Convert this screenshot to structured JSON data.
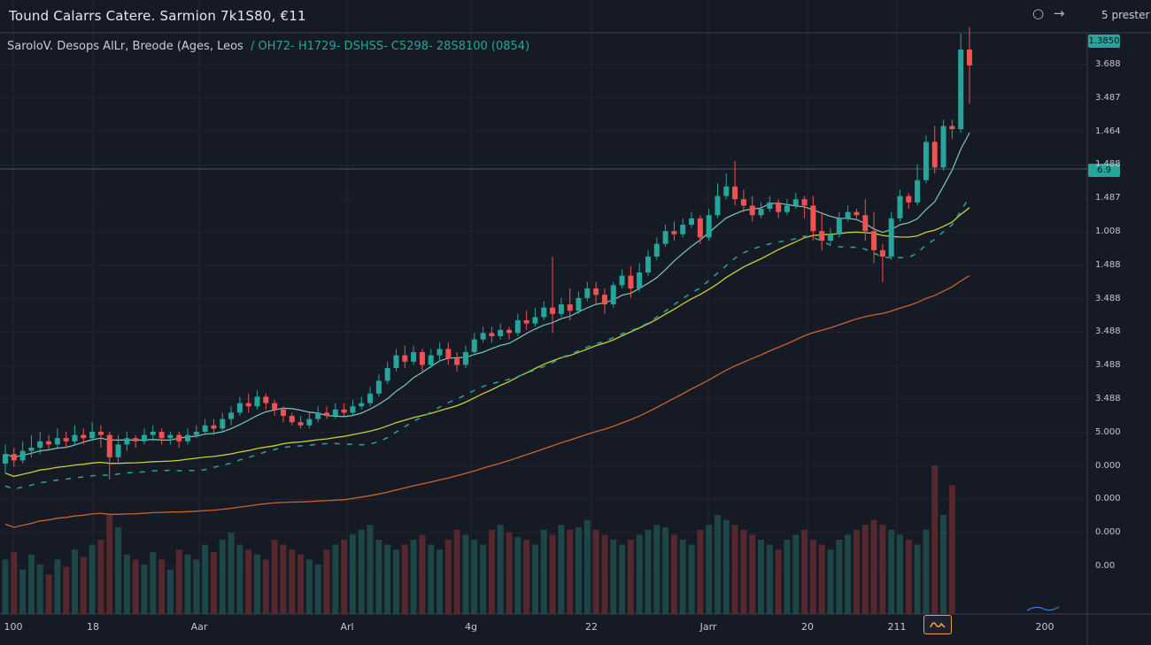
{
  "header": {
    "title": "Tound Calarrs Catere. Sarmion  7k1S80, €11",
    "subtitle": "SaroloV. Desops AlLr, Breode (Ages, Leos",
    "ohlc": "/ OH72- H1729- DSHSS- C5298- 28S8100 (0854)",
    "preset_label": "5 prester",
    "icon_circle": "○",
    "icon_arrow": "→"
  },
  "price_tags": {
    "top": "1.3850",
    "current": "6.9"
  },
  "icons": {
    "chart_toggle": "chart-wave-icon"
  },
  "colors": {
    "background": "#161a25",
    "up": "#26a69a",
    "down": "#ef5350",
    "ma_fast": "#7ec9b8",
    "ma_mid": "#c8d033",
    "ma_slow": "#c8632c",
    "ma_dashed": "#26a69a"
  },
  "chart_data": {
    "type": "candlestick",
    "y_tick_labels": [
      "3.688",
      "3.487",
      "1.464",
      "1.488",
      "1.487",
      "1.008",
      "1.488",
      "3.488",
      "3.488",
      "3.488",
      "3.488",
      "5.000",
      "0.000",
      "0.000",
      "0.000",
      "0.00"
    ],
    "x_tick_labels": [
      "100",
      "18",
      "Aar",
      "Arl",
      "4g",
      "22",
      "Jarr",
      "20",
      "211",
      "200"
    ],
    "ylim": [
      0,
      100
    ],
    "candles": [
      [
        15,
        18,
        12,
        21
      ],
      [
        18,
        16,
        14,
        20
      ],
      [
        16,
        19,
        15,
        22
      ],
      [
        19,
        20,
        17,
        24
      ],
      [
        20,
        22,
        18,
        25
      ],
      [
        22,
        21,
        19,
        24
      ],
      [
        21,
        23,
        20,
        26
      ],
      [
        23,
        22,
        20,
        25
      ],
      [
        22,
        24,
        21,
        27
      ],
      [
        24,
        23,
        21,
        26
      ],
      [
        23,
        25,
        22,
        28
      ],
      [
        25,
        24,
        20,
        27
      ],
      [
        24,
        17,
        10,
        25
      ],
      [
        17,
        21,
        15,
        24
      ],
      [
        21,
        23,
        19,
        25
      ],
      [
        23,
        22,
        20,
        24
      ],
      [
        22,
        24,
        21,
        26
      ],
      [
        24,
        25,
        22,
        27
      ],
      [
        25,
        23,
        21,
        26
      ],
      [
        23,
        24,
        21,
        25
      ],
      [
        24,
        22,
        20,
        25
      ],
      [
        22,
        24,
        21,
        26
      ],
      [
        24,
        25,
        23,
        27
      ],
      [
        25,
        27,
        24,
        29
      ],
      [
        27,
        26,
        24,
        29
      ],
      [
        26,
        29,
        25,
        31
      ],
      [
        29,
        31,
        27,
        33
      ],
      [
        31,
        34,
        30,
        36
      ],
      [
        34,
        33,
        31,
        37
      ],
      [
        33,
        36,
        32,
        38
      ],
      [
        36,
        34,
        32,
        37
      ],
      [
        34,
        32,
        30,
        35
      ],
      [
        32,
        30,
        28,
        33
      ],
      [
        30,
        28,
        27,
        31
      ],
      [
        28,
        27,
        26,
        30
      ],
      [
        27,
        29,
        26,
        31
      ],
      [
        29,
        31,
        28,
        33
      ],
      [
        31,
        30,
        29,
        33
      ],
      [
        30,
        32,
        29,
        34
      ],
      [
        32,
        31,
        30,
        34
      ],
      [
        31,
        33,
        30,
        35
      ],
      [
        33,
        34,
        32,
        36
      ],
      [
        34,
        37,
        33,
        39
      ],
      [
        37,
        41,
        36,
        43
      ],
      [
        41,
        45,
        40,
        47
      ],
      [
        45,
        49,
        44,
        51
      ],
      [
        49,
        47,
        45,
        52
      ],
      [
        47,
        50,
        46,
        52
      ],
      [
        50,
        46,
        44,
        51
      ],
      [
        46,
        49,
        45,
        51
      ],
      [
        49,
        51,
        47,
        53
      ],
      [
        51,
        48,
        46,
        53
      ],
      [
        48,
        46,
        44,
        50
      ],
      [
        46,
        50,
        45,
        52
      ],
      [
        50,
        54,
        49,
        56
      ],
      [
        54,
        56,
        53,
        58
      ],
      [
        56,
        55,
        53,
        58
      ],
      [
        55,
        57,
        54,
        59
      ],
      [
        57,
        56,
        54,
        58
      ],
      [
        56,
        60,
        55,
        62
      ],
      [
        60,
        59,
        57,
        63
      ],
      [
        59,
        61,
        58,
        64
      ],
      [
        61,
        64,
        60,
        66
      ],
      [
        64,
        62,
        56,
        80
      ],
      [
        62,
        65,
        61,
        67
      ],
      [
        65,
        63,
        60,
        70
      ],
      [
        63,
        67,
        62,
        69
      ],
      [
        67,
        70,
        66,
        72
      ],
      [
        70,
        68,
        65,
        72
      ],
      [
        68,
        65,
        62,
        70
      ],
      [
        65,
        71,
        64,
        72
      ],
      [
        71,
        74,
        70,
        76
      ],
      [
        74,
        70,
        67,
        77
      ],
      [
        70,
        75,
        69,
        78
      ],
      [
        75,
        80,
        74,
        82
      ],
      [
        80,
        84,
        79,
        86
      ],
      [
        84,
        88,
        83,
        90
      ],
      [
        88,
        87,
        85,
        91
      ],
      [
        87,
        90,
        86,
        92
      ],
      [
        90,
        92,
        89,
        94
      ],
      [
        92,
        86,
        84,
        93
      ],
      [
        86,
        93,
        85,
        95
      ],
      [
        93,
        99,
        92,
        103
      ],
      [
        99,
        102,
        98,
        106
      ],
      [
        102,
        98,
        96,
        110
      ],
      [
        98,
        96,
        94,
        101
      ],
      [
        96,
        93,
        91,
        99
      ],
      [
        93,
        95,
        92,
        97
      ],
      [
        95,
        97,
        94,
        99
      ],
      [
        97,
        94,
        92,
        98
      ],
      [
        94,
        96,
        93,
        98
      ],
      [
        96,
        98,
        95,
        100
      ],
      [
        98,
        96,
        92,
        99
      ],
      [
        96,
        88,
        85,
        99
      ],
      [
        88,
        85,
        82,
        94
      ],
      [
        85,
        87,
        84,
        89
      ],
      [
        87,
        92,
        86,
        94
      ],
      [
        92,
        94,
        91,
        96
      ],
      [
        94,
        93,
        92,
        95
      ],
      [
        93,
        88,
        85,
        98
      ],
      [
        88,
        82,
        78,
        94
      ],
      [
        82,
        80,
        72,
        84
      ],
      [
        80,
        92,
        79,
        94
      ],
      [
        92,
        99,
        91,
        101
      ],
      [
        99,
        97,
        95,
        100
      ],
      [
        97,
        104,
        96,
        109
      ],
      [
        104,
        116,
        103,
        118
      ],
      [
        116,
        108,
        106,
        121
      ],
      [
        108,
        121,
        107,
        123
      ],
      [
        121,
        120,
        117,
        123
      ],
      [
        120,
        145,
        119,
        150
      ],
      [
        145,
        140,
        128,
        152
      ]
    ],
    "volume": [
      22,
      25,
      18,
      24,
      20,
      16,
      22,
      19,
      26,
      23,
      28,
      30,
      40,
      35,
      24,
      22,
      20,
      25,
      22,
      18,
      26,
      24,
      22,
      28,
      25,
      30,
      33,
      28,
      26,
      24,
      22,
      30,
      28,
      26,
      24,
      22,
      20,
      26,
      28,
      30,
      32,
      34,
      36,
      30,
      28,
      26,
      28,
      30,
      32,
      28,
      26,
      30,
      34,
      32,
      30,
      28,
      34,
      36,
      33,
      31,
      30,
      28,
      34,
      32,
      36,
      34,
      35,
      38,
      34,
      32,
      30,
      28,
      30,
      32,
      34,
      36,
      35,
      32,
      30,
      28,
      34,
      36,
      40,
      38,
      36,
      34,
      32,
      30,
      28,
      26,
      30,
      32,
      34,
      30,
      28,
      26,
      30,
      32,
      34,
      36,
      38,
      36,
      34,
      32,
      30,
      28,
      34,
      60,
      40,
      52
    ]
  }
}
